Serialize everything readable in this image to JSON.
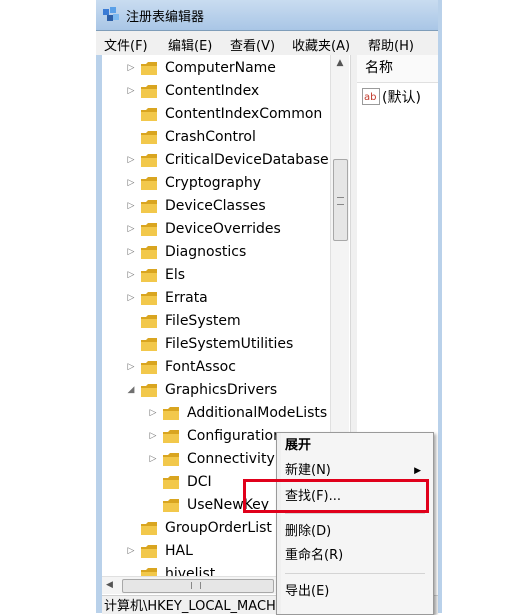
{
  "window": {
    "title": "注册表编辑器",
    "app_icon": "regedit-icon"
  },
  "menu": [
    "文件(F)",
    "编辑(E)",
    "查看(V)",
    "收藏夹(A)",
    "帮助(H)"
  ],
  "tree": {
    "items": [
      {
        "label": "ComputerName",
        "expander": "▷"
      },
      {
        "label": "ContentIndex",
        "expander": "▷"
      },
      {
        "label": "ContentIndexCommon",
        "expander": ""
      },
      {
        "label": "CrashControl",
        "expander": ""
      },
      {
        "label": "CriticalDeviceDatabase",
        "expander": "▷"
      },
      {
        "label": "Cryptography",
        "expander": "▷"
      },
      {
        "label": "DeviceClasses",
        "expander": "▷"
      },
      {
        "label": "DeviceOverrides",
        "expander": "▷"
      },
      {
        "label": "Diagnostics",
        "expander": "▷"
      },
      {
        "label": "Els",
        "expander": "▷"
      },
      {
        "label": "Errata",
        "expander": "▷"
      },
      {
        "label": "FileSystem",
        "expander": ""
      },
      {
        "label": "FileSystemUtilities",
        "expander": ""
      },
      {
        "label": "FontAssoc",
        "expander": "▷"
      },
      {
        "label": "GraphicsDrivers",
        "expander": "◢"
      },
      {
        "label": "AdditionalModeLists",
        "expander": "▷"
      },
      {
        "label": "Configuration",
        "expander": "▷"
      },
      {
        "label": "Connectivity",
        "expander": "▷"
      },
      {
        "label": "DCI",
        "expander": ""
      },
      {
        "label": "UseNewKey",
        "expander": ""
      },
      {
        "label": "GroupOrderList",
        "expander": ""
      },
      {
        "label": "HAL",
        "expander": "▷"
      },
      {
        "label": "hivelist",
        "expander": ""
      }
    ]
  },
  "values_pane": {
    "column_header": "名称",
    "rows": [
      {
        "name": "(默认)",
        "icon": "string-value-icon"
      }
    ]
  },
  "status_bar": {
    "path": "计算机\\HKEY_LOCAL_MACHINE"
  },
  "context_menu": {
    "items": [
      {
        "label": "展开",
        "bold": true,
        "submenu": false
      },
      {
        "label": "新建(N)",
        "bold": false,
        "submenu": true
      },
      {
        "label": "查找(F)...",
        "bold": false,
        "submenu": false,
        "highlighted": true
      },
      {
        "label": "删除(D)",
        "bold": false,
        "submenu": false
      },
      {
        "label": "重命名(R)",
        "bold": false,
        "submenu": false
      },
      {
        "label": "导出(E)",
        "bold": false,
        "submenu": false
      }
    ],
    "highlight_color": "#e0001b"
  },
  "colors": {
    "folder": "#f2c84b",
    "window_frame": "#b9d1ea"
  }
}
